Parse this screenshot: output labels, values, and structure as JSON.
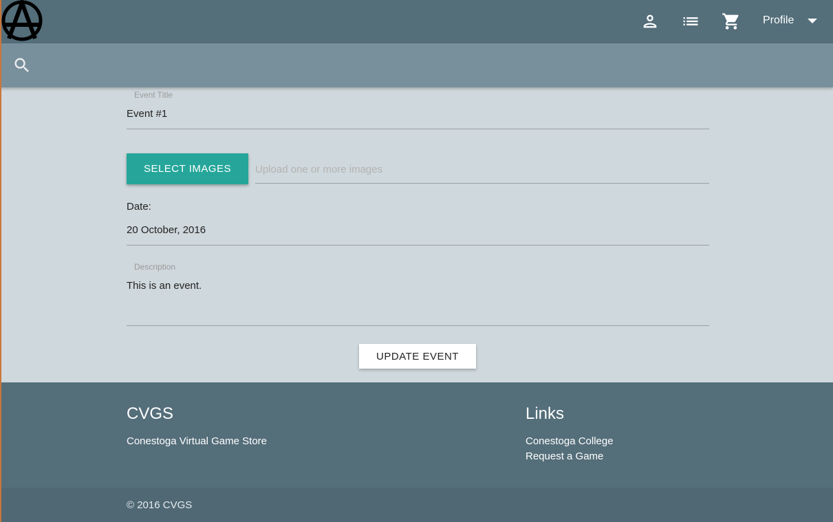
{
  "header": {
    "logo": "anarchy-logo",
    "icons": [
      "person-icon",
      "list-icon",
      "cart-icon"
    ],
    "profile_label": "Profile"
  },
  "search": {
    "icon": "search-icon"
  },
  "form": {
    "event_title_label": "Event Title",
    "event_title_value": "Event #1",
    "select_images_label": "SELECT IMAGES",
    "upload_placeholder": "Upload one or more images",
    "date_label": "Date:",
    "date_value": "20 October, 2016",
    "description_label": "Description",
    "description_value": "This is an event.",
    "update_button_label": "UPDATE EVENT"
  },
  "footer": {
    "brand_title": "CVGS",
    "brand_text": "Conestoga Virtual Game Store",
    "links_title": "Links",
    "links": [
      "Conestoga College",
      "Request a Game"
    ],
    "copyright": "© 2016 CVGS"
  },
  "colors": {
    "header_bg": "#546e7a",
    "search_bg": "#78909c",
    "page_bg": "#cfd8dc",
    "accent": "#26a69a"
  }
}
